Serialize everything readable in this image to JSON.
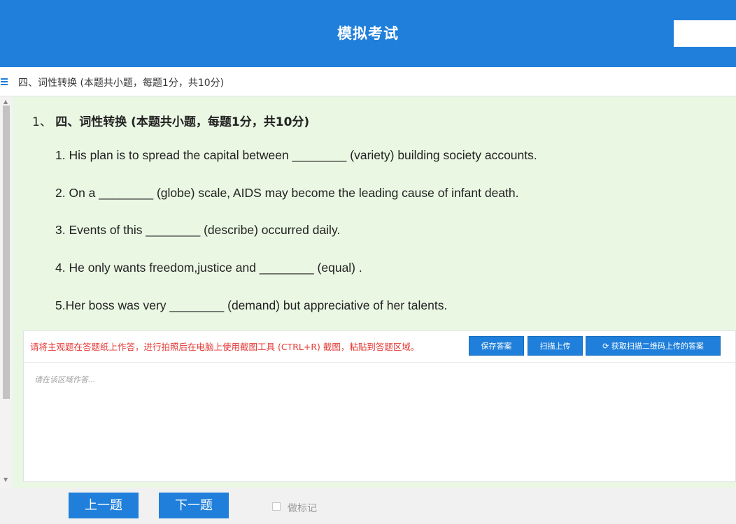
{
  "header": {
    "title": "模拟考试"
  },
  "section": {
    "title": "四、词性转换 (本题共小题，每题1分，共10分)"
  },
  "question": {
    "number": "1、",
    "title": "四、词性转换 (本题共小题，每题1分，共10分)",
    "lines": [
      "1. His plan is to spread the capital between ________  (variety)  building society accounts.",
      "2. On a ________  (globe)  scale, AIDS may become the leading cause of infant death.",
      "3. Events of this ________   (describe)  occurred daily.",
      "4. He only wants freedom,justice and ________ (equal) .",
      "5.Her boss was very ________ (demand) but appreciative of her talents."
    ]
  },
  "answer": {
    "hint": "请将主观题在答题纸上作答，进行拍照后在电脑上使用截图工具 (CTRL+R) 截图，粘贴到答题区域。",
    "save_label": "保存答案",
    "scan_label": "扫描上传",
    "fetch_label": "获取扫描二维码上传的答案",
    "placeholder": "请在该区域作答..."
  },
  "footer": {
    "prev_label": "上一题",
    "next_label": "下一题",
    "mark_label": "做标记"
  },
  "colors": {
    "primary": "#1f7fdb",
    "content_bg": "#e9f7e3",
    "hint": "#e53935"
  }
}
